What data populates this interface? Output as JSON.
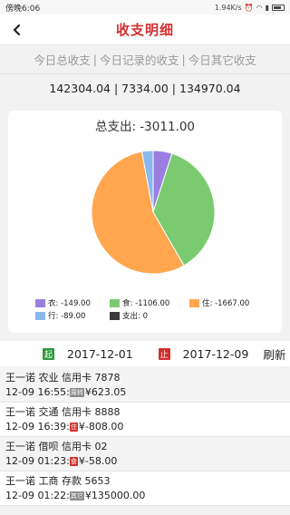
{
  "status_bar": {
    "time": "傍晚6:06",
    "speed": "1.94K/s"
  },
  "header": {
    "title": "收支明细"
  },
  "tabs": [
    {
      "label": "今日总收支"
    },
    {
      "label": "今日记录的收支"
    },
    {
      "label": "今日其它收支"
    }
  ],
  "tab_separator": "|",
  "totals": {
    "text": "142304.04 | 7334.00 | 134970.04"
  },
  "chart_data": {
    "type": "pie",
    "title": "总支出: -3011.00",
    "slices": [
      {
        "label": "衣",
        "value": -149.0,
        "legend": "衣: -149.00",
        "color": "#9b7fe0"
      },
      {
        "label": "食",
        "value": -1106.0,
        "legend": "食: -1106.00",
        "color": "#7acb6f"
      },
      {
        "label": "住",
        "value": -1667.0,
        "legend": "住: -1667.00",
        "color": "#ffa64f"
      },
      {
        "label": "行",
        "value": -89.0,
        "legend": "行: -89.00",
        "color": "#8ab8ec"
      },
      {
        "label": "支出",
        "value": 0,
        "legend": "支出: 0",
        "color": "#3c3c3c"
      }
    ],
    "legend_position": "bottom"
  },
  "date_filter": {
    "start_badge": "起",
    "start_date": "2017-12-01",
    "end_badge": "止",
    "end_date": "2017-12-09",
    "refresh_label": "刷新"
  },
  "transactions": [
    {
      "line1": "王一诺 农业 信用卡 7878",
      "time": "12-09 16:55:",
      "tag": "周转",
      "tag_color": "#8a8a8a",
      "amount": "¥623.05"
    },
    {
      "line1": "王一诺 交通 信用卡 8888",
      "time": "12-09 16:39:",
      "tag": "住",
      "tag_color": "#d32f2f",
      "amount": "¥-808.00"
    },
    {
      "line1": "王一诺 借呗 信用卡 02",
      "time": "12-09 01:23:",
      "tag": "食",
      "tag_color": "#d32f2f",
      "amount": "¥-58.00"
    },
    {
      "line1": "王一诺 工商 存款 5653",
      "time": "12-09 01:22:",
      "tag": "其它",
      "tag_color": "#8a8a8a",
      "amount": "¥135000.00"
    }
  ]
}
